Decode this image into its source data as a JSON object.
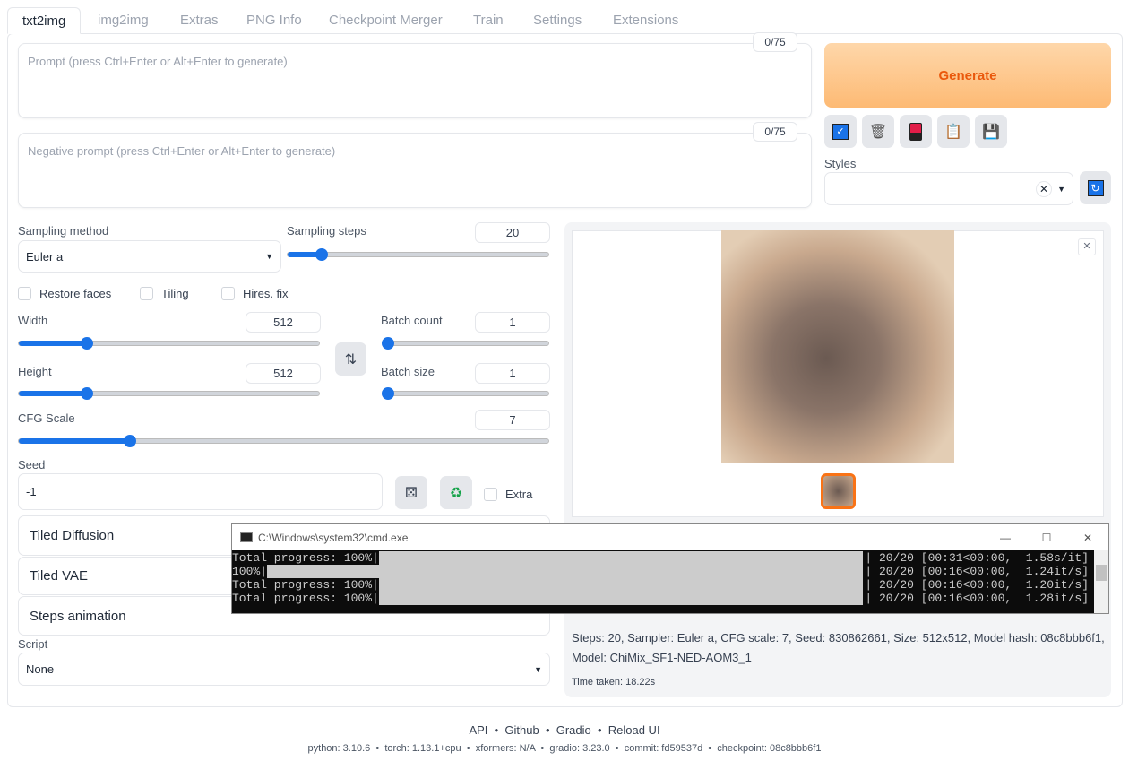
{
  "tabs": [
    "txt2img",
    "img2img",
    "Extras",
    "PNG Info",
    "Checkpoint Merger",
    "Train",
    "Settings",
    "Extensions"
  ],
  "prompt": {
    "placeholder": "Prompt (press Ctrl+Enter or Alt+Enter to generate)",
    "counter": "0/75"
  },
  "negative_prompt": {
    "placeholder": "Negative prompt (press Ctrl+Enter or Alt+Enter to generate)",
    "counter": "0/75"
  },
  "generate_label": "Generate",
  "styles_label": "Styles",
  "sampling": {
    "method_label": "Sampling method",
    "method": "Euler a",
    "steps_label": "Sampling steps",
    "steps": "20",
    "steps_fraction": 0.13
  },
  "checkboxes": [
    "Restore faces",
    "Tiling",
    "Hires. fix"
  ],
  "width": {
    "label": "Width",
    "value": "512",
    "fraction": 0.226
  },
  "height": {
    "label": "Height",
    "value": "512",
    "fraction": 0.226
  },
  "batch_count": {
    "label": "Batch count",
    "value": "1",
    "fraction": 0
  },
  "batch_size": {
    "label": "Batch size",
    "value": "1",
    "fraction": 0
  },
  "cfg": {
    "label": "CFG Scale",
    "value": "7",
    "fraction": 0.21
  },
  "seed": {
    "label": "Seed",
    "value": "-1",
    "extra": "Extra"
  },
  "accordions": [
    "Tiled Diffusion",
    "Tiled VAE",
    "Steps animation"
  ],
  "script": {
    "label": "Script",
    "value": "None"
  },
  "info": {
    "line1": "Steps: 20, Sampler: Euler a, CFG scale: 7, Seed: 830862661, Size: 512x512, Model hash: 08c8bbb6f1,",
    "line2": "Model: ChiMix_SF1-NED-AOM3_1",
    "time": "Time taken: 18.22s"
  },
  "cmd": {
    "title": "C:\\Windows\\system32\\cmd.exe",
    "rows": [
      {
        "left": "Total progress: 100%|",
        "right": "| 20/20 [00:31<00:00,  1.58s/it]"
      },
      {
        "left": "100%|",
        "right": "| 20/20 [00:16<00:00,  1.24it/s]"
      },
      {
        "left": "Total progress: 100%|",
        "right": "| 20/20 [00:16<00:00,  1.20it/s]"
      },
      {
        "left": "Total progress: 100%|",
        "right": "| 20/20 [00:16<00:00,  1.28it/s]"
      }
    ]
  },
  "footer": {
    "links": [
      "API",
      "Github",
      "Gradio",
      "Reload UI"
    ],
    "versions": "python: 3.10.6  •  torch: 1.13.1+cpu  •  xformers: N/A  •  gradio: 3.23.0  •  commit: fd59537d  •  checkpoint: 08c8bbb6f1"
  },
  "colors": {
    "accent": "#1a73e8",
    "generate": "#ea580c"
  }
}
